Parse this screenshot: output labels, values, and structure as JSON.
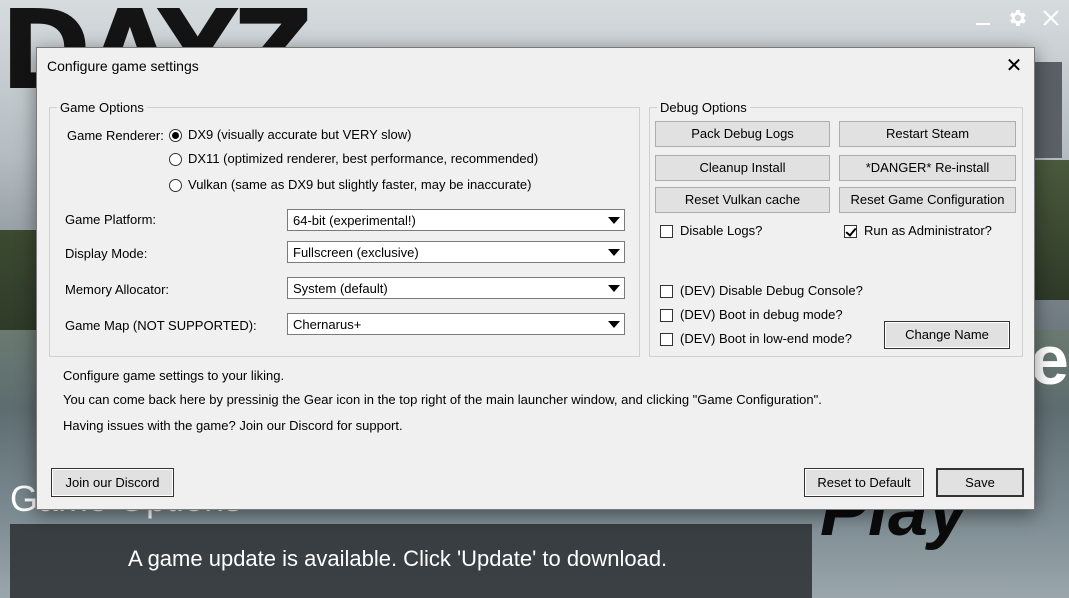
{
  "background": {
    "logo_text": "DAYZ",
    "play_text": "Play",
    "game_options_text": "Game Options",
    "update_message": "A game update is available. Click 'Update' to download."
  },
  "launcher_controls": {
    "minimize_icon": "minimize-icon",
    "settings_icon": "gear-icon",
    "close_icon": "close-icon"
  },
  "dialog": {
    "title": "Configure game settings",
    "close_glyph": "✕",
    "game_options": {
      "legend": "Game Options",
      "renderer_label": "Game Renderer:",
      "renderer_options": [
        {
          "label": "DX9 (visually accurate but VERY slow)",
          "selected": true
        },
        {
          "label": "DX11 (optimized renderer, best performance, recommended)",
          "selected": false
        },
        {
          "label": "Vulkan (same as DX9 but slightly faster, may be inaccurate)",
          "selected": false
        }
      ],
      "platform_label": "Game Platform:",
      "platform_value": "64-bit (experimental!)",
      "display_label": "Display Mode:",
      "display_value": "Fullscreen (exclusive)",
      "memory_label": "Memory Allocator:",
      "memory_value": "System (default)",
      "map_label": "Game Map (NOT SUPPORTED):",
      "map_value": "Chernarus+"
    },
    "debug_options": {
      "legend": "Debug Options",
      "pack_logs": "Pack Debug Logs",
      "restart_steam": "Restart Steam",
      "cleanup_install": "Cleanup Install",
      "reinstall": "*DANGER* Re-install",
      "reset_vulkan": "Reset Vulkan cache",
      "reset_config": "Reset Game Configuration",
      "disable_logs": {
        "label": "Disable Logs?",
        "checked": false
      },
      "run_admin": {
        "label": "Run as Administrator?",
        "checked": true
      },
      "disable_console": {
        "label": "(DEV) Disable Debug Console?",
        "checked": false
      },
      "boot_debug": {
        "label": "(DEV) Boot in debug mode?",
        "checked": false
      },
      "boot_lowend": {
        "label": "(DEV) Boot in low-end mode?",
        "checked": false
      },
      "change_name": "Change Name"
    },
    "info_lines": [
      "Configure game settings to your liking.",
      "You can come back here by pressinig the Gear icon in the top right of the main launcher window, and clicking \"Game Configuration\".",
      "Having issues with the game? Join our Discord for support."
    ],
    "footer": {
      "discord": "Join our Discord",
      "reset_default": "Reset to Default",
      "save": "Save"
    }
  }
}
